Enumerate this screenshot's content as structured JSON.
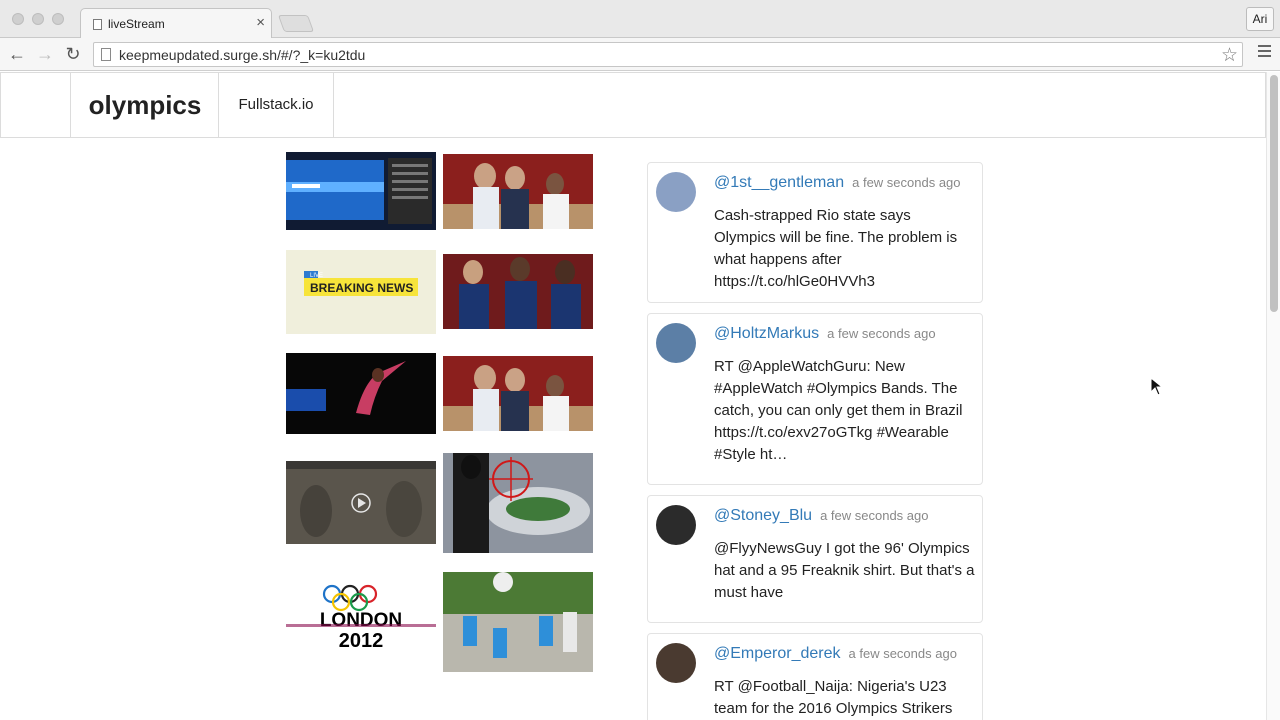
{
  "browser": {
    "tab_title": "liveStream",
    "tab_close": "×",
    "url": "keepmeupdated.surge.sh/#/?_k=ku2tdu",
    "profile": "Ari",
    "back_icon": "←",
    "forward_icon": "→",
    "reload_icon": "↻",
    "star_icon": "☆"
  },
  "navbar": {
    "brand": "olympics",
    "link": "Fullstack.io"
  },
  "media": [
    {
      "name": "swimming-pool-screen",
      "colors": [
        "#0d2a6b",
        "#2e78d6"
      ]
    },
    {
      "name": "usa-basketball-coach",
      "colors": [
        "#7d1a18",
        "#e9eef6"
      ]
    },
    {
      "name": "breaking-news",
      "colors": [
        "#ecebd3",
        "#f6e94a"
      ]
    },
    {
      "name": "usa-basketball-players",
      "colors": [
        "#6f1b1c",
        "#17305f"
      ]
    },
    {
      "name": "gymnast",
      "colors": [
        "#0a0a0a",
        "#d04b6a"
      ]
    },
    {
      "name": "usa-basketball-coach-2",
      "colors": [
        "#7d1a18",
        "#e9eef6"
      ]
    },
    {
      "name": "video-frame",
      "colors": [
        "#555047",
        "#8a8578"
      ]
    },
    {
      "name": "stadium-target",
      "colors": [
        "#6d7280",
        "#1d1d1d"
      ]
    },
    {
      "name": "london-2012-logo",
      "colors": [
        "#ffffff",
        "#000000"
      ]
    },
    {
      "name": "kids-basketball",
      "colors": [
        "#3d6b2a",
        "#b8c9d6"
      ]
    }
  ],
  "london_logo": {
    "line1": "LONDON",
    "line2": "2012"
  },
  "breaking_news": {
    "live": "LIVE",
    "text": "BREAKING NEWS"
  },
  "tweets": [
    {
      "handle": "@1st__gentleman",
      "time": "a few seconds ago",
      "text": "Cash-strapped Rio state says Olympics will be fine. The problem is what happens after https://t.co/hlGe0HVVh3",
      "avatar_color": "#8aa0c4"
    },
    {
      "handle": "@HoltzMarkus",
      "time": "a few seconds ago",
      "text": "RT @AppleWatchGuru: New #AppleWatch #Olympics Bands. The catch, you can only get them in Brazil https://t.co/exv27oGTkg #Wearable #Style ht…",
      "avatar_color": "#5c7fa6"
    },
    {
      "handle": "@Stoney_Blu",
      "time": "a few seconds ago",
      "text": "@FlyyNewsGuy I got the 96' Olympics hat and a 95 Freaknik shirt. But that's a must have",
      "avatar_color": "#2b2b2b"
    },
    {
      "handle": "@Emperor_derek",
      "time": "a few seconds ago",
      "text": "RT @Football_Naija: Nigeria's U23 team for the 2016 Olympics Strikers",
      "avatar_color": "#4a3a30"
    }
  ]
}
